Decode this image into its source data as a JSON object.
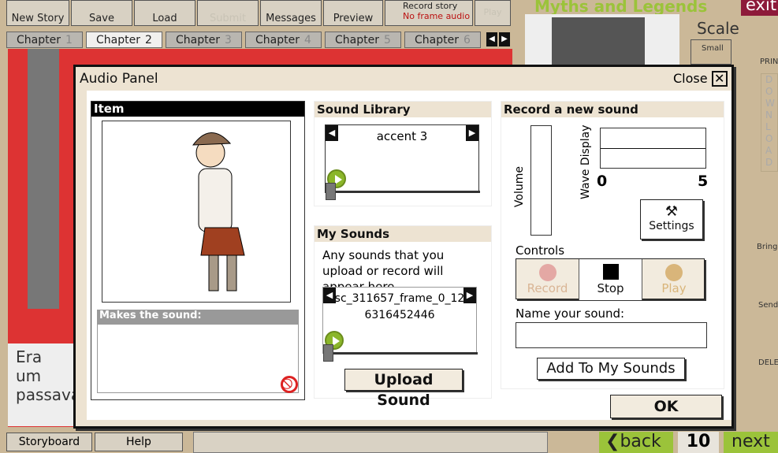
{
  "toolbar": {
    "new_story": "New Story",
    "save": "Save",
    "load": "Load",
    "submit": "Submit",
    "messages": "Messages",
    "preview": "Preview",
    "record_story": "Record story",
    "no_frame_audio": "No frame audio",
    "play_audio": "Play",
    "play_audio_sub": "Audio"
  },
  "chapters": [
    {
      "label": "Chapter",
      "num": "1"
    },
    {
      "label": "Chapter",
      "num": "2"
    },
    {
      "label": "Chapter",
      "num": "3"
    },
    {
      "label": "Chapter",
      "num": "4"
    },
    {
      "label": "Chapter",
      "num": "5"
    },
    {
      "label": "Chapter",
      "num": "6"
    }
  ],
  "active_chapter": 2,
  "brand": {
    "logo": "Myths and Legends",
    "exit": "exit"
  },
  "right_panel": {
    "scale": "Scale",
    "small": "Small",
    "print": "PRINT",
    "download": "DOWNLOAD",
    "bring_front": "Bring to FRONT",
    "send_back": "Send to BACK",
    "delete": "DELETE"
  },
  "story_text": {
    "line1": "Era um",
    "line2": "passava"
  },
  "modal": {
    "title": "Audio Panel",
    "close": "Close",
    "item": {
      "header": "Item",
      "makes_sound_label": "Makes the sound:",
      "makes_sound_value": ""
    },
    "library": {
      "header": "Sound Library",
      "current": "accent 3",
      "progress": 0
    },
    "my_sounds": {
      "header": "My Sounds",
      "hint": "Any sounds that you upload or record will appear here",
      "current_line1": "sc_311657_frame_0_12",
      "current_line2": "6316452446",
      "progress": 0,
      "upload": "Upload Sound"
    },
    "record": {
      "header": "Record a new sound",
      "volume": "Volume",
      "wave": "Wave Display",
      "axis_min": "0",
      "axis_max": "5",
      "settings": "Settings",
      "controls": "Controls",
      "record": "Record",
      "stop": "Stop",
      "play": "Play",
      "name_label": "Name your sound:",
      "name_value": "",
      "add": "Add To My Sounds"
    },
    "ok": "OK"
  },
  "bottom": {
    "storyboard": "Storyboard",
    "help": "Help",
    "back": "back",
    "page": "10",
    "next": "next"
  },
  "colors": {
    "accent_green": "#9bc33a",
    "record_disabled": "#e4a8a4",
    "play_disabled": "#d9b57a"
  }
}
